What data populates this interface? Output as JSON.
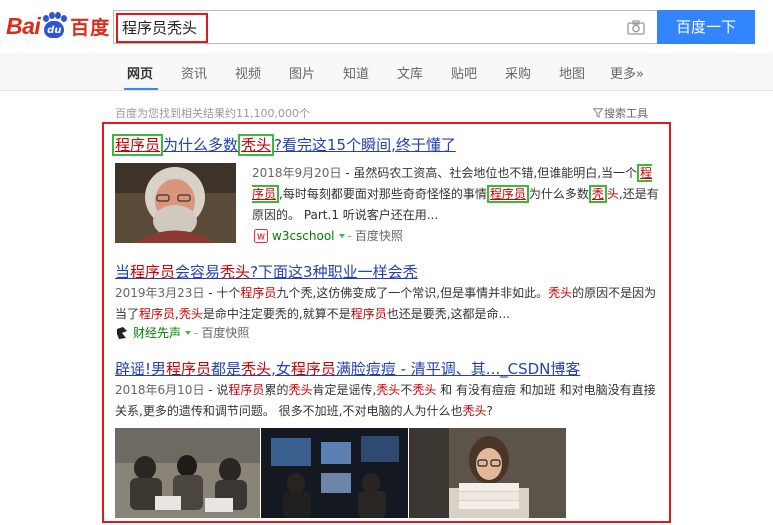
{
  "logo": {
    "bai": "Bai",
    "du": "du",
    "cn": "百度"
  },
  "search": {
    "query": "程序员秃头",
    "button_label": "百度一下"
  },
  "tabs": [
    {
      "label": "网页"
    },
    {
      "label": "资讯"
    },
    {
      "label": "视频"
    },
    {
      "label": "图片"
    },
    {
      "label": "知道"
    },
    {
      "label": "文库"
    },
    {
      "label": "贴吧"
    },
    {
      "label": "采购"
    },
    {
      "label": "地图"
    },
    {
      "label": "更多»"
    }
  ],
  "result_count": "百度为您找到相关结果约11,100,000个",
  "tools_label": "搜索工具",
  "results": [
    {
      "title": {
        "t1": "程序员",
        "t2": "为什么多数",
        "t3": "秃头",
        "t4": "?看完这15个瞬间,终于懂了"
      },
      "snippet": {
        "date": "2018年9月20日",
        "s1": " - 虽然码农工资高、社会地位也不错,但谁能明白,当一个",
        "s2": "程序员",
        "s3": ",每时每刻都要面对那些奇奇怪怪的事情",
        "s4": "程序员",
        "s5": "为什么多数",
        "s6": "秃",
        "s7": "头",
        "s8": ",还是有原因的。 Part.1 听说客户还在用..."
      },
      "source": "w3cschool",
      "snapshot": "百度快照"
    },
    {
      "title": {
        "t1": "当",
        "t2": "程序员",
        "t3": "会容易",
        "t4": "秃头",
        "t5": "?下面这3种职业一样会秃"
      },
      "snippet": {
        "date": "2019年3月23日",
        "s1": " - 十个",
        "s2": "程序员",
        "s3": "九个秃,这仿佛变成了一个常识,但是事情并非如此。",
        "s4": "秃头",
        "s5": "的原因不是因为当了",
        "s6": "程序员",
        "s7": ",",
        "s8": "秃头",
        "s9": "是命中注定要秃的,就算不是",
        "s10": "程序员",
        "s11": "也还是要秃,这都是命..."
      },
      "source": "财经先声",
      "snapshot": "百度快照"
    },
    {
      "title": {
        "t1": "辟谣!男",
        "t2": "程序员",
        "t3": "都是",
        "t4": "秃头",
        "t5": ",女",
        "t6": "程序员",
        "t7": "满脸痘痘 - 清平调、其..._CSDN博客"
      },
      "snippet": {
        "date": "2018年6月10日",
        "s1": " - 说",
        "s2": "程序员",
        "s3": "累的",
        "s4": "秃头",
        "s5": "肯定是谣传,",
        "s6": "秃头",
        "s7": "不",
        "s8": "秃头",
        "s9": " 和 有没有痘痘 和加班 和对电脑没有直接关系,更多的遗传和调节问题。 很多不加班,不对电脑的人为什么也",
        "s10": "秃头",
        "s11": "?"
      }
    }
  ],
  "colors": {
    "link": "#2440b3",
    "highlight": "#cc0000",
    "frame_red": "#e0191d",
    "frame_green": "#3cb83c",
    "button_blue": "#3385ff"
  }
}
